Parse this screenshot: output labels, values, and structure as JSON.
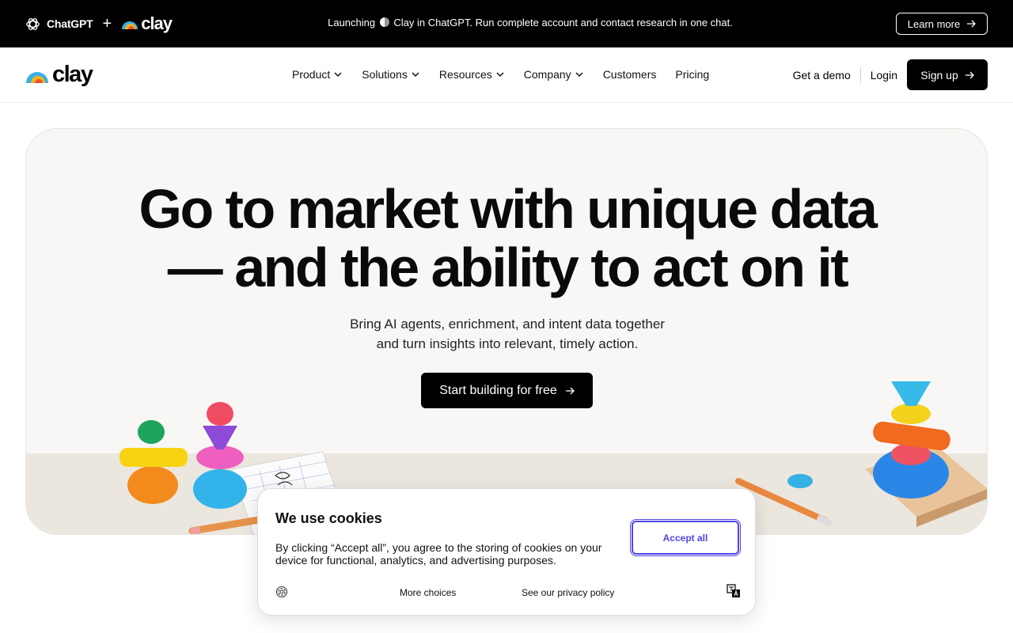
{
  "banner": {
    "chatgpt": "ChatGPT",
    "plus": "+",
    "clay": "clay",
    "text_prefix": "Launching",
    "text_suffix": "Clay in ChatGPT. Run complete account and contact research in one chat.",
    "learn_more": "Learn more"
  },
  "nav": {
    "logo": "clay",
    "items": [
      {
        "label": "Product",
        "dropdown": true
      },
      {
        "label": "Solutions",
        "dropdown": true
      },
      {
        "label": "Resources",
        "dropdown": true
      },
      {
        "label": "Company",
        "dropdown": true
      },
      {
        "label": "Customers",
        "dropdown": false
      },
      {
        "label": "Pricing",
        "dropdown": false
      }
    ],
    "demo": "Get a demo",
    "login": "Login",
    "signup": "Sign up"
  },
  "hero": {
    "title_line1": "Go to market with unique data",
    "title_line2": "— and the ability to act on it",
    "sub_line1": "Bring AI agents, enrichment, and intent data together",
    "sub_line2": "and turn insights into relevant, timely action.",
    "cta": "Start building for free"
  },
  "cookie": {
    "title": "We use cookies",
    "text": "By clicking “Accept all”, you agree to the storing of cookies on your device for functional, analytics, and advertising purposes.",
    "accept": "Accept all",
    "more_choices": "More choices",
    "privacy": "See our privacy policy"
  },
  "colors": {
    "banner_bg": "#000000",
    "hero_bg": "#f8f7f5",
    "accent_blue": "#4f46e5"
  }
}
